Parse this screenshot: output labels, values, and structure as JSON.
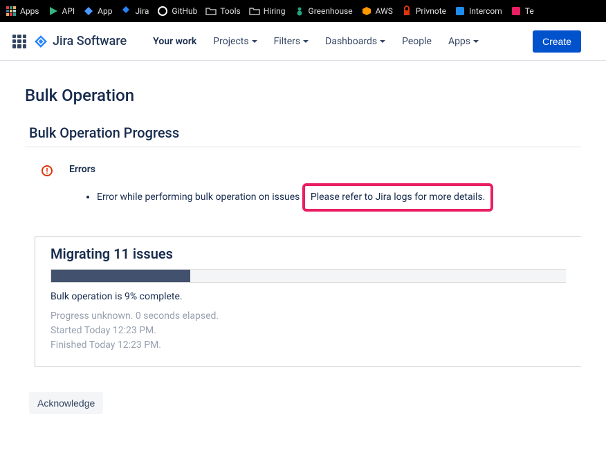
{
  "bookmarks": [
    {
      "label": "Apps",
      "icon": "grid"
    },
    {
      "label": "API",
      "icon": "play-green"
    },
    {
      "label": "App",
      "icon": "diamond-blue"
    },
    {
      "label": "Jira",
      "icon": "jira-diamond"
    },
    {
      "label": "GitHub",
      "icon": "github"
    },
    {
      "label": "Tools",
      "icon": "folder"
    },
    {
      "label": "Hiring",
      "icon": "folder"
    },
    {
      "label": "Greenhouse",
      "icon": "greenhouse"
    },
    {
      "label": "AWS",
      "icon": "aws"
    },
    {
      "label": "Privnote",
      "icon": "lock-red"
    },
    {
      "label": "Intercom",
      "icon": "intercom"
    },
    {
      "label": "Te",
      "icon": "pink"
    }
  ],
  "appName": "Jira Software",
  "nav": {
    "yourWork": "Your work",
    "projects": "Projects",
    "filters": "Filters",
    "dashboards": "Dashboards",
    "people": "People",
    "apps": "Apps",
    "create": "Create"
  },
  "page": {
    "title": "Bulk Operation",
    "sectionTitle": "Bulk Operation Progress"
  },
  "errors": {
    "heading": "Errors",
    "messagePart1": "Error while performing bulk operation on issues ",
    "messagePart2": "Please refer to Jira logs for more details."
  },
  "progress": {
    "title": "Migrating 11 issues",
    "percent": 9,
    "statusText": "Bulk operation is 9% complete.",
    "unknownText": "Progress unknown. 0 seconds elapsed.",
    "startedText": "Started Today 12:23 PM.",
    "finishedText": "Finished Today 12:23 PM."
  },
  "acknowledge": "Acknowledge"
}
